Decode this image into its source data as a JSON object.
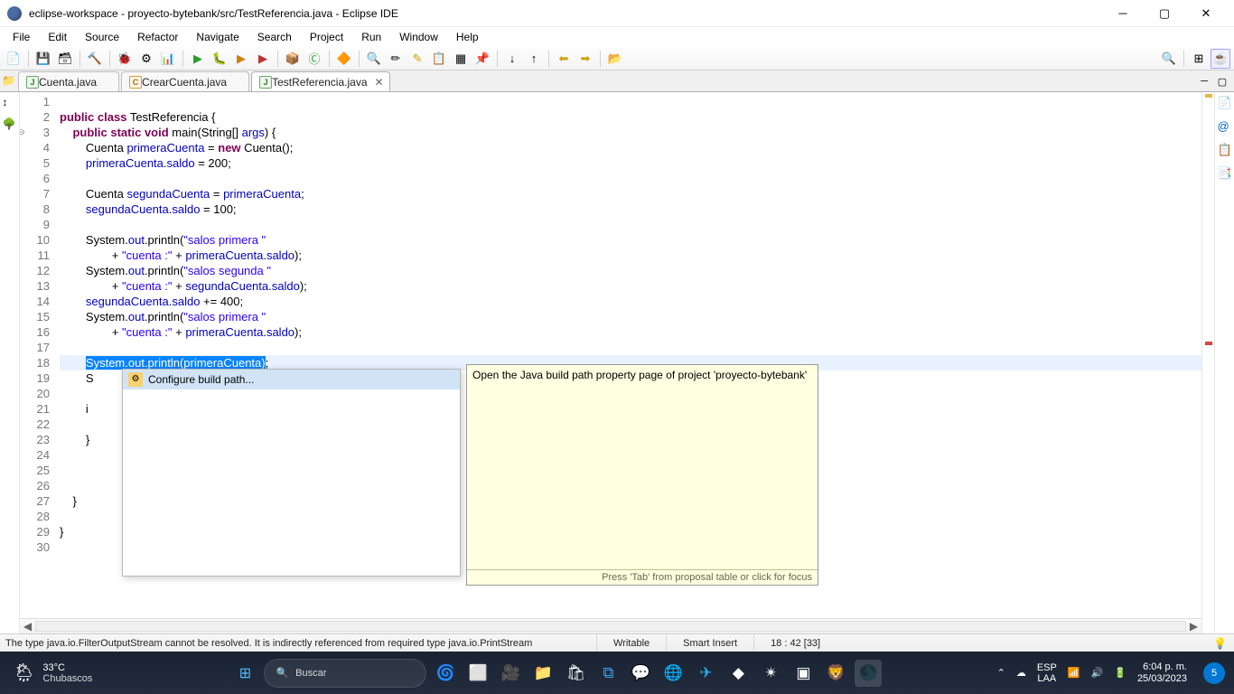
{
  "titlebar": {
    "text": "eclipse-workspace - proyecto-bytebank/src/TestReferencia.java - Eclipse IDE"
  },
  "menu": [
    "File",
    "Edit",
    "Source",
    "Refactor",
    "Navigate",
    "Search",
    "Project",
    "Run",
    "Window",
    "Help"
  ],
  "tabs": [
    {
      "label": "Cuenta.java",
      "active": false,
      "icon": "J"
    },
    {
      "label": "CrearCuenta.java",
      "active": false,
      "icon": "C"
    },
    {
      "label": "TestReferencia.java",
      "active": true,
      "icon": "J"
    }
  ],
  "code": {
    "lines": [
      {
        "n": 1,
        "t": ""
      },
      {
        "n": 2,
        "t": "public class TestReferencia {",
        "tok": [
          [
            "kw",
            "public"
          ],
          [
            "p",
            " "
          ],
          [
            "kw",
            "class"
          ],
          [
            "p",
            " TestReferencia {"
          ]
        ]
      },
      {
        "n": 3,
        "fold": true,
        "t": "    public static void main(String[] args) {",
        "tok": [
          [
            "p",
            "    "
          ],
          [
            "kw",
            "public"
          ],
          [
            "p",
            " "
          ],
          [
            "kw",
            "static"
          ],
          [
            "p",
            " "
          ],
          [
            "kw",
            "void"
          ],
          [
            "p",
            " main(String[] "
          ],
          [
            "fld",
            "args"
          ],
          [
            "p",
            ") {"
          ]
        ]
      },
      {
        "n": 4,
        "t": "        Cuenta primeraCuenta = new Cuenta();",
        "tok": [
          [
            "p",
            "        Cuenta "
          ],
          [
            "fld",
            "primeraCuenta"
          ],
          [
            "p",
            " = "
          ],
          [
            "kw",
            "new"
          ],
          [
            "p",
            " Cuenta();"
          ]
        ]
      },
      {
        "n": 5,
        "t": "        primeraCuenta.saldo = 200;",
        "tok": [
          [
            "p",
            "        "
          ],
          [
            "fld",
            "primeraCuenta"
          ],
          [
            "p",
            "."
          ],
          [
            "fld",
            "saldo"
          ],
          [
            "p",
            " = 200;"
          ]
        ]
      },
      {
        "n": 6,
        "t": ""
      },
      {
        "n": 7,
        "t": "        Cuenta segundaCuenta = primeraCuenta;",
        "tok": [
          [
            "p",
            "        Cuenta "
          ],
          [
            "fld",
            "segundaCuenta"
          ],
          [
            "p",
            " = "
          ],
          [
            "fld",
            "primeraCuenta"
          ],
          [
            "p",
            ";"
          ]
        ]
      },
      {
        "n": 8,
        "t": "        segundaCuenta.saldo = 100;",
        "tok": [
          [
            "p",
            "        "
          ],
          [
            "fld",
            "segundaCuenta"
          ],
          [
            "p",
            "."
          ],
          [
            "fld",
            "saldo"
          ],
          [
            "p",
            " = 100;"
          ]
        ]
      },
      {
        "n": 9,
        "t": ""
      },
      {
        "n": 10,
        "t": "        System.out.println(\"salos primera \"",
        "tok": [
          [
            "p",
            "        System."
          ],
          [
            "fld",
            "out"
          ],
          [
            "p",
            ".println("
          ],
          [
            "str",
            "\"salos primera \""
          ]
        ]
      },
      {
        "n": 11,
        "t": "                + \"cuenta :\" + primeraCuenta.saldo);",
        "tok": [
          [
            "p",
            "                + "
          ],
          [
            "str",
            "\"cuenta :\""
          ],
          [
            "p",
            " + "
          ],
          [
            "fld",
            "primeraCuenta"
          ],
          [
            "p",
            "."
          ],
          [
            "fld",
            "saldo"
          ],
          [
            "p",
            ");"
          ]
        ]
      },
      {
        "n": 12,
        "t": "        System.out.println(\"salos segunda \"",
        "tok": [
          [
            "p",
            "        System."
          ],
          [
            "fld",
            "out"
          ],
          [
            "p",
            ".println("
          ],
          [
            "str",
            "\"salos segunda \""
          ]
        ]
      },
      {
        "n": 13,
        "t": "                + \"cuenta :\" + segundaCuenta.saldo);",
        "tok": [
          [
            "p",
            "                + "
          ],
          [
            "str",
            "\"cuenta :\""
          ],
          [
            "p",
            " + "
          ],
          [
            "fld",
            "segundaCuenta"
          ],
          [
            "p",
            "."
          ],
          [
            "fld",
            "saldo"
          ],
          [
            "p",
            ");"
          ]
        ]
      },
      {
        "n": 14,
        "t": "        segundaCuenta.saldo += 400;",
        "tok": [
          [
            "p",
            "        "
          ],
          [
            "fld",
            "segundaCuenta"
          ],
          [
            "p",
            "."
          ],
          [
            "fld",
            "saldo"
          ],
          [
            "p",
            " += 400;"
          ]
        ]
      },
      {
        "n": 15,
        "t": "        System.out.println(\"salos primera \"",
        "tok": [
          [
            "p",
            "        System."
          ],
          [
            "fld",
            "out"
          ],
          [
            "p",
            ".println("
          ],
          [
            "str",
            "\"salos primera \""
          ]
        ]
      },
      {
        "n": 16,
        "t": "                + \"cuenta :\" + primeraCuenta.saldo);",
        "tok": [
          [
            "p",
            "                + "
          ],
          [
            "str",
            "\"cuenta :\""
          ],
          [
            "p",
            " + "
          ],
          [
            "fld",
            "primeraCuenta"
          ],
          [
            "p",
            "."
          ],
          [
            "fld",
            "saldo"
          ],
          [
            "p",
            ");"
          ]
        ]
      },
      {
        "n": 17,
        "t": ""
      },
      {
        "n": 18,
        "err": true,
        "hl": true,
        "sel": "System.out.println(primeraCuenta)",
        "after": ";"
      },
      {
        "n": 19,
        "t": "        S"
      },
      {
        "n": 20,
        "t": ""
      },
      {
        "n": 21,
        "t": "        i"
      },
      {
        "n": 22,
        "t": ""
      },
      {
        "n": 23,
        "t": "        }"
      },
      {
        "n": 24,
        "t": ""
      },
      {
        "n": 25,
        "t": ""
      },
      {
        "n": 26,
        "t": ""
      },
      {
        "n": 27,
        "t": "    }"
      },
      {
        "n": 28,
        "t": ""
      },
      {
        "n": 29,
        "t": "}"
      },
      {
        "n": 30,
        "t": ""
      }
    ]
  },
  "quickfix": {
    "item": "Configure build path..."
  },
  "tooltip": {
    "body": "Open the Java build path property page of project 'proyecto-bytebank'",
    "foot": "Press 'Tab' from proposal table or click for focus"
  },
  "status": {
    "msg": "The type java.io.FilterOutputStream cannot be resolved. It is indirectly referenced from required type java.io.PrintStream",
    "writable": "Writable",
    "insert": "Smart Insert",
    "pos": "18 : 42 [33]"
  },
  "weather": {
    "temp": "33°C",
    "cond": "Chubascos"
  },
  "search_placeholder": "Buscar",
  "tray": {
    "lang1": "ESP",
    "lang2": "LAA",
    "time": "6:04 p. m.",
    "date": "25/03/2023",
    "notif": "5"
  }
}
